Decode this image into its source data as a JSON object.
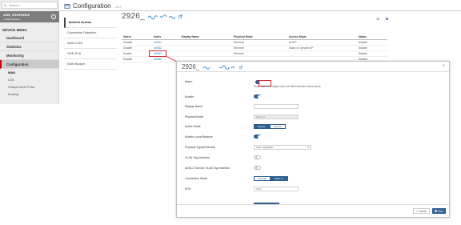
{
  "sidebar": {
    "search_placeholder": "Search...",
    "device_name": "2926_EKNPARKS",
    "device_status": "( Total Devices )",
    "menu_title": "DEVICE MENU",
    "items": [
      {
        "label": "Dashboard"
      },
      {
        "label": "Statistics"
      },
      {
        "label": "Monitoring"
      },
      {
        "label": "Configuration"
      }
    ],
    "subitems": [
      {
        "label": "WAN"
      },
      {
        "label": "LAN"
      },
      {
        "label": "Hotspot Web Portal"
      },
      {
        "label": "Routing"
      }
    ]
  },
  "header": {
    "title": "Configuration",
    "version": "- v2.0"
  },
  "subnav": [
    {
      "label": "Internet Access"
    },
    {
      "label": "Connection Detection"
    },
    {
      "label": "Multi-VLAN"
    },
    {
      "label": "GRE-IPv6"
    },
    {
      "label": "WAN Budget"
    }
  ],
  "device_heading": {
    "name": "2926_"
  },
  "table": {
    "headers": [
      "Alarm",
      "Index",
      "Display Name",
      "Physical Mode",
      "Access Mode",
      "Status"
    ],
    "rows": [
      [
        "Disable",
        "WAN1",
        "",
        "Ethernet",
        "DHCP",
        "Disable"
      ],
      [
        "Disable",
        "WAN2",
        "",
        "Ethernet",
        "Static or Dynamic IP",
        "Disable"
      ],
      [
        "Enable",
        "WAN3",
        "",
        "Ethernet",
        "",
        "Disable"
      ],
      [
        "Disable",
        "WAN4",
        "",
        "",
        "",
        "Disable"
      ]
    ]
  },
  "modal": {
    "title": "2926_",
    "fields": {
      "alarm_label": "Alarm",
      "alarm_hint": "Show alarm message when the WAN interface disconnects.",
      "enable_label": "Enable",
      "display_name_label": "Display Name",
      "physical_mode_label": "Physical Mode",
      "physical_mode_value": "Ethernet",
      "active_mode_label": "Active Mode",
      "active_mode_options": [
        "Always On",
        "Failover"
      ],
      "local_balance_label": "Enable Local Balance",
      "phy_type_label": "Physical Type(Ethernet)",
      "phy_type_value": "Auto-negotiation",
      "vlan_label": "VLAN Tag Insertion",
      "adsl_vlan_label": "ADSL2 Service VLAN Tag Insertion",
      "conn_mode_label": "Connection Mode",
      "conn_mode_options": [
        "Settings",
        "Static or Dynamic IP"
      ],
      "mtu_label": "MTU",
      "mtu_value": "1500"
    },
    "cancel_label": "Cancel",
    "save_label": "Save"
  },
  "colors": {
    "accent": "#2f5f8f",
    "highlight": "#d9232d",
    "sidebar_bg": "#ececec"
  }
}
